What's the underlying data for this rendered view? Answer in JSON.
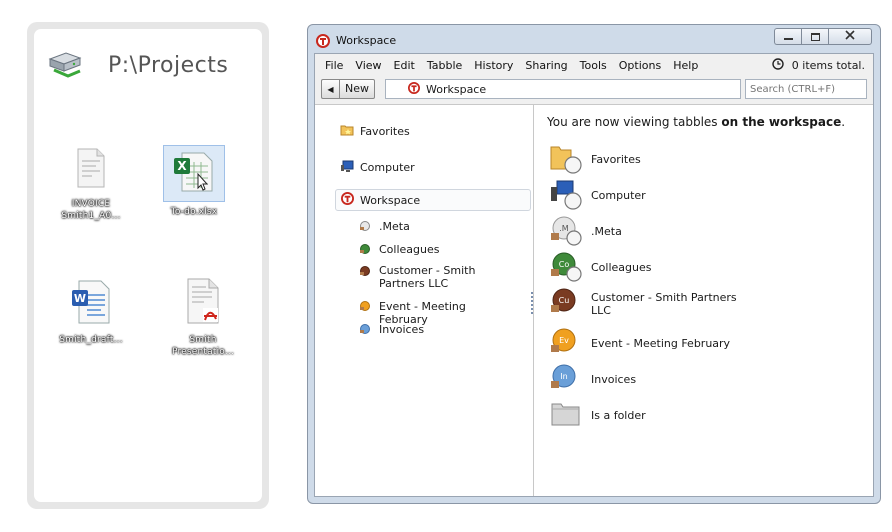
{
  "folder": {
    "title": "P:\\Projects",
    "files": [
      {
        "name": "INVOICE Smith1_A0...",
        "line1": "INVOICE",
        "line2": "Smith1_A0...",
        "icon": "document-icon"
      },
      {
        "name": "To-do.xlsx",
        "line1": "To-do.xlsx",
        "line2": "",
        "icon": "excel-file-icon"
      },
      {
        "name": "Smith_draft...",
        "line1": "Smith_draft...",
        "line2": "",
        "icon": "word-file-icon"
      },
      {
        "name": "Smith Presentatio...",
        "line1": "Smith",
        "line2": "Presentatio...",
        "icon": "pdf-file-icon"
      }
    ]
  },
  "window": {
    "title": "Workspace",
    "controls": {
      "minimize": "minimize",
      "maximize": "maximize",
      "close": "close"
    }
  },
  "menu": [
    "File",
    "View",
    "Edit",
    "Tabble",
    "History",
    "Sharing",
    "Tools",
    "Options",
    "Help"
  ],
  "status": {
    "items_total": "0 items total."
  },
  "toolbar": {
    "new_label": "New",
    "address": "Workspace",
    "search_placeholder": "Search (CTRL+F)"
  },
  "tree": {
    "favorites": "Favorites",
    "computer": "Computer",
    "workspace": "Workspace",
    "children": [
      {
        "label": ".Meta",
        "color": "#d9d9d9"
      },
      {
        "label": "Colleagues",
        "color": "#3f8a3a"
      },
      {
        "label": "Customer - Smith Partners LLC",
        "color": "#7a3b22"
      },
      {
        "label": "Event - Meeting February",
        "color": "#f0a020"
      },
      {
        "label": "Invoices",
        "color": "#6a9fd8"
      }
    ]
  },
  "main": {
    "heading_prefix": "You are now viewing tabbles ",
    "heading_bold": "on the workspace",
    "heading_suffix": ".",
    "items": [
      {
        "label": "Favorites"
      },
      {
        "label": "Computer"
      },
      {
        "label": ".Meta",
        "abbr": ".M"
      },
      {
        "label": "Colleagues",
        "abbr": "Co"
      },
      {
        "label": "Customer - Smith Partners LLC",
        "abbr": "Cu"
      },
      {
        "label": "Event - Meeting February",
        "abbr": "Ev"
      },
      {
        "label": "Invoices",
        "abbr": "In"
      },
      {
        "label": "Is a folder"
      }
    ]
  },
  "colors": {
    "accent": "#c8281e",
    "window_frame": "#cfdbe9",
    "selection": "#dce9f7"
  }
}
